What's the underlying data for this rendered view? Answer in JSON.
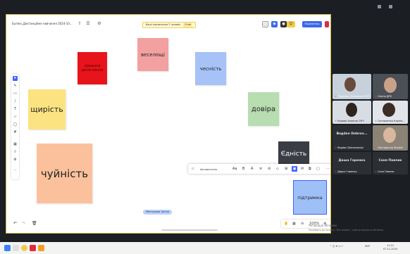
{
  "board": {
    "title": "Буліно_Дистанційне навчання 2024-10...",
    "viewers_label": "Ваші підписники:7 чоловік",
    "viewers_stop": "Стоп",
    "share_label": "Поділитись",
    "author_tag": "Ментроцев Зигіна",
    "zoom": "100%"
  },
  "stickies": [
    {
      "text": "зірвання досягнення",
      "color": "#e8141b"
    },
    {
      "text": "веселощі",
      "color": "#f3a0a0"
    },
    {
      "text": "чесність",
      "color": "#a7c2f7"
    },
    {
      "text": "щирість",
      "color": "#fbe381"
    },
    {
      "text": "довіра",
      "color": "#b7ddb0"
    },
    {
      "text": "чуйність",
      "color": "#fbc19c"
    },
    {
      "text": "Єдність",
      "color": "#3a3e44"
    },
    {
      "text": "підтримка",
      "color": "#9fbff7"
    }
  ],
  "context_bar": {
    "font_label": "Автоматично",
    "size_label": "Аа"
  },
  "participants": [
    {
      "name": "Людмила Лісовська ОЛЧ"
    },
    {
      "name": "Олена ДРХ"
    },
    {
      "name": "Корява Анжела ОЛЧ"
    },
    {
      "name": "Сигналенко Каріна..."
    },
    {
      "name": "Bogdan Dobrovolskyi",
      "big": "Bogdan Dobrov..."
    },
    {
      "name": "Нестеренко Зіновія"
    },
    {
      "name": "Дарья Горенко",
      "big": "Даша Горенко"
    },
    {
      "name": "Соня Павлик",
      "big": "Соня Павлик"
    }
  ],
  "windows_activate": {
    "line1": "Активація Windows",
    "line2": "Перейдіть до розділу \"Настройка\", щоб активувати Windows."
  },
  "taskbar": {
    "lang": "УКР",
    "time": "11:12",
    "date": "07.11.2024"
  },
  "colors": {
    "accent": "#3b68e8",
    "record_red": "#e02b3c",
    "board_border": "#c9b73d"
  }
}
